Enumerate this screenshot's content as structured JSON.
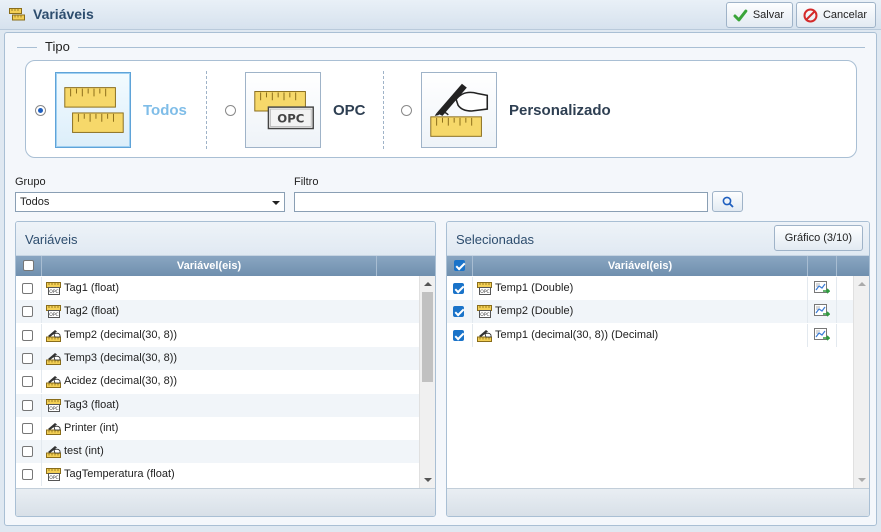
{
  "window": {
    "title": "Variáveis",
    "save_label": "Salvar",
    "cancel_label": "Cancelar"
  },
  "tipo": {
    "legend": "Tipo",
    "options": [
      {
        "label": "Todos",
        "selected": true,
        "icon": "rulers-icon"
      },
      {
        "label": "OPC",
        "selected": false,
        "icon": "opc-ruler-icon"
      },
      {
        "label": "Personalizado",
        "selected": false,
        "icon": "hand-pen-ruler-icon"
      }
    ]
  },
  "filters": {
    "grupo_label": "Grupo",
    "grupo_value": "Todos",
    "filtro_label": "Filtro",
    "filtro_value": ""
  },
  "left_panel": {
    "title": "Variáveis",
    "column": "Variável(eis)",
    "rows": [
      {
        "name": "Tag1 (float)",
        "icon": "opc-icon",
        "checked": false
      },
      {
        "name": "Tag2 (float)",
        "icon": "opc-icon",
        "checked": false
      },
      {
        "name": "Temp2 (decimal(30, 8))",
        "icon": "custom-pen-icon",
        "checked": false
      },
      {
        "name": "Temp3 (decimal(30, 8))",
        "icon": "custom-pen-icon",
        "checked": false
      },
      {
        "name": "Acidez (decimal(30, 8))",
        "icon": "custom-pen-icon",
        "checked": false
      },
      {
        "name": "Tag3 (float)",
        "icon": "opc-icon",
        "checked": false
      },
      {
        "name": "Printer (int)",
        "icon": "custom-pen-icon",
        "checked": false
      },
      {
        "name": "test (int)",
        "icon": "custom-pen-icon",
        "checked": false
      },
      {
        "name": "TagTemperatura (float)",
        "icon": "opc-icon",
        "checked": false
      }
    ]
  },
  "right_panel": {
    "title": "Selecionadas",
    "chart_button": "Gráfico (3/10)",
    "column": "Variável(eis)",
    "rows": [
      {
        "name": "Temp1 (Double)",
        "icon": "opc-icon",
        "checked": true
      },
      {
        "name": "Temp2 (Double)",
        "icon": "opc-icon",
        "checked": true
      },
      {
        "name": "Temp1 (decimal(30, 8)) (Decimal)",
        "icon": "custom-pen-icon",
        "checked": true
      }
    ]
  },
  "colors": {
    "accent": "#1a73c9",
    "selected_label": "#7fbde8",
    "grid_header": "#7b98b6"
  }
}
